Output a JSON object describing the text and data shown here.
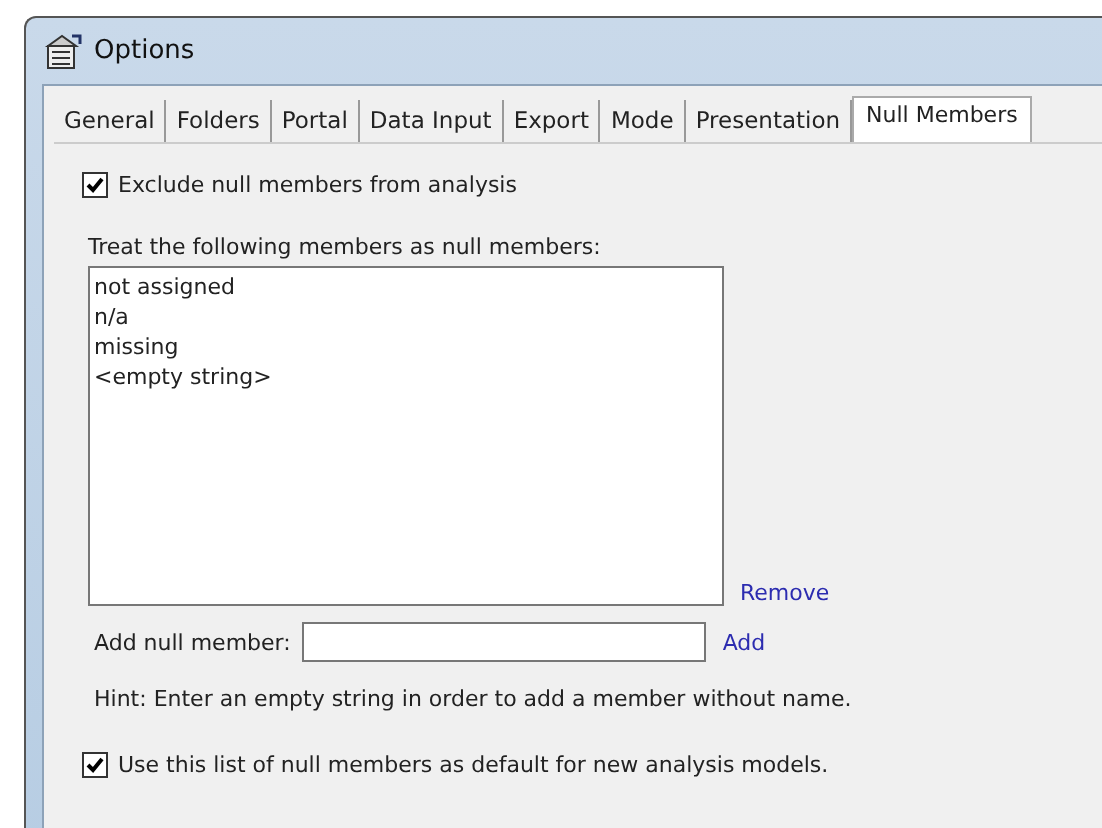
{
  "window": {
    "title": "Options"
  },
  "tabs": [
    {
      "label": "General",
      "selected": false
    },
    {
      "label": "Folders",
      "selected": false
    },
    {
      "label": "Portal",
      "selected": false
    },
    {
      "label": "Data Input",
      "selected": false
    },
    {
      "label": "Export",
      "selected": false
    },
    {
      "label": "Mode",
      "selected": false
    },
    {
      "label": "Presentation",
      "selected": false
    },
    {
      "label": "Null Members",
      "selected": true
    }
  ],
  "exclude_checkbox": {
    "label": "Exclude null members from analysis",
    "checked": true
  },
  "list_label": "Treat the following members as null members:",
  "null_members": [
    "not assigned",
    "n/a",
    "missing",
    "<empty string>"
  ],
  "remove_link": "Remove",
  "add_field": {
    "label": "Add null member:"
  },
  "add_link": "Add",
  "hint": "Hint: Enter an empty string in order to add a member without name.",
  "default_checkbox": {
    "label": "Use this list of null members as default for new analysis models.",
    "checked": true
  }
}
